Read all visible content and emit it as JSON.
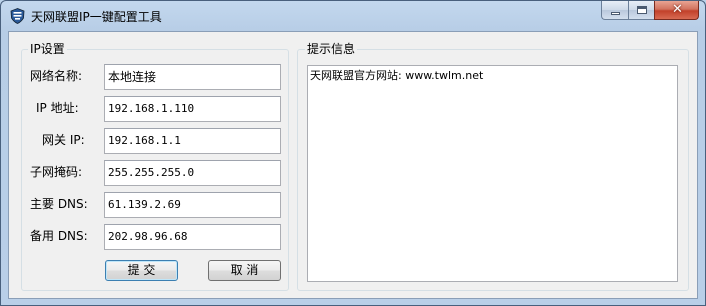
{
  "window": {
    "title": "天网联盟IP一键配置工具",
    "icons": {
      "app": "app-shield-icon",
      "minimize": "minimize-icon",
      "maximize": "maximize-icon",
      "close": "close-icon"
    },
    "close_glyph": "✕"
  },
  "ip_settings": {
    "legend": "IP设置",
    "fields": [
      {
        "label": "网络名称:",
        "value": "本地连接"
      },
      {
        "label": "IP 地址:",
        "value": "192.168.1.110"
      },
      {
        "label": "网关 IP:",
        "value": "192.168.1.1"
      },
      {
        "label": "子网掩码:",
        "value": "255.255.255.0"
      },
      {
        "label": "主要 DNS:",
        "value": "61.139.2.69"
      },
      {
        "label": "备用 DNS:",
        "value": "202.98.96.68"
      }
    ],
    "submit_label": "提 交",
    "cancel_label": "取 消"
  },
  "info": {
    "legend": "提示信息",
    "text": "天网联盟官方网站: www.twlm.net"
  },
  "colors": {
    "window_frame": "#bcd3ea",
    "client_bg": "#f0f0f0",
    "close_button": "#c2412a",
    "default_button_border": "#3c7fb1"
  }
}
